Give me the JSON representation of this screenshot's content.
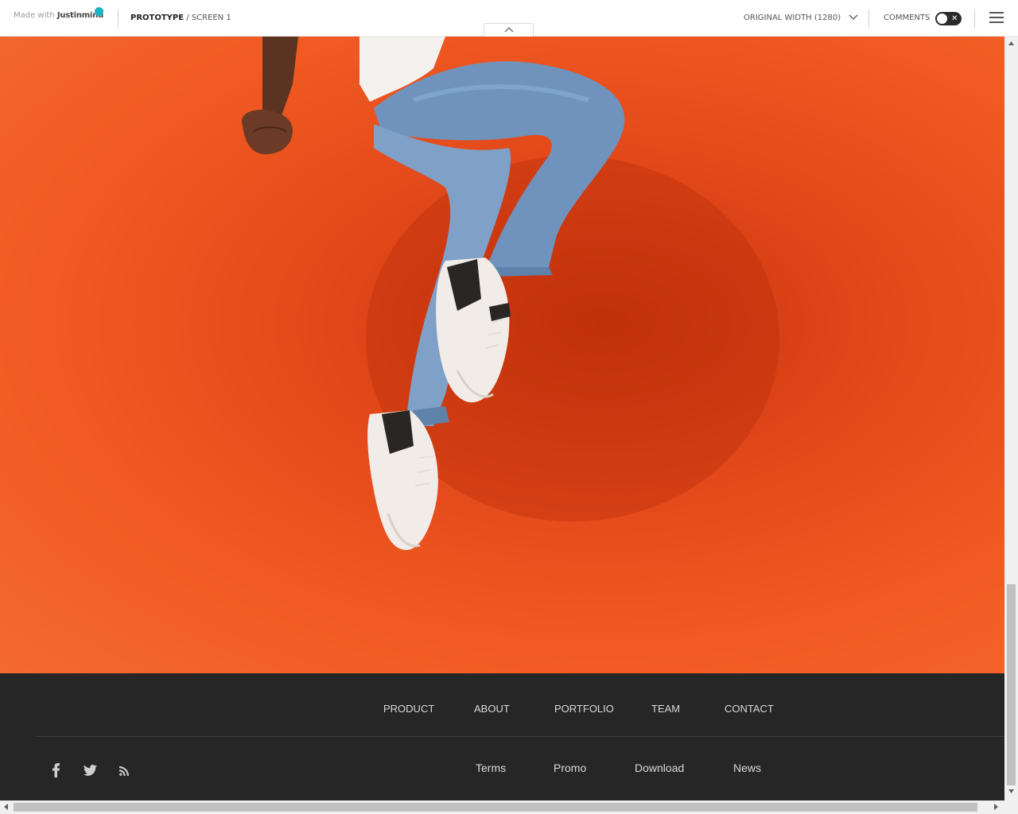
{
  "toolbar": {
    "brand_prefix": "Made with",
    "brand_name": "Justinmind",
    "breadcrumb_root": "PROTOTYPE",
    "breadcrumb_sep": " / ",
    "breadcrumb_screen": "SCREEN 1",
    "width_label": "ORIGINAL WIDTH (1280)",
    "comments_label": "COMMENTS",
    "comments_toggle_state": "off",
    "accent_color": "#1ab4c4"
  },
  "hero": {
    "image_subject": "person jumping in jeans and white sneakers against orange wall",
    "background_color": "#f15a22"
  },
  "footer": {
    "background_color": "#262626",
    "nav": [
      {
        "label": "PRODUCT"
      },
      {
        "label": "ABOUT"
      },
      {
        "label": "PORTFOLIO"
      },
      {
        "label": "TEAM"
      },
      {
        "label": "CONTACT"
      }
    ],
    "links": [
      {
        "label": "Terms"
      },
      {
        "label": "Promo"
      },
      {
        "label": "Download"
      },
      {
        "label": "News"
      }
    ],
    "social": [
      "facebook-icon",
      "twitter-icon",
      "rss-icon"
    ]
  }
}
